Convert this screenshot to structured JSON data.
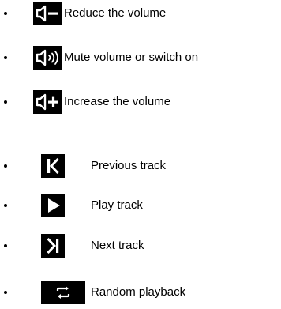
{
  "volume_controls": [
    {
      "icon": "volume-down-icon",
      "label": "Reduce the volume"
    },
    {
      "icon": "volume-mute-toggle-icon",
      "label": "Mute volume or switch on"
    },
    {
      "icon": "volume-up-icon",
      "label": "Increase the volume"
    }
  ],
  "track_controls": [
    {
      "icon": "previous-track-icon",
      "label": "Previous track"
    },
    {
      "icon": "play-icon",
      "label": "Play track"
    },
    {
      "icon": "next-track-icon",
      "label": "Next track"
    },
    {
      "icon": "shuffle-icon",
      "label": "Random playback"
    }
  ],
  "colors": {
    "icon_background": "#000000",
    "icon_foreground": "#ffffff",
    "text": "#000000"
  }
}
